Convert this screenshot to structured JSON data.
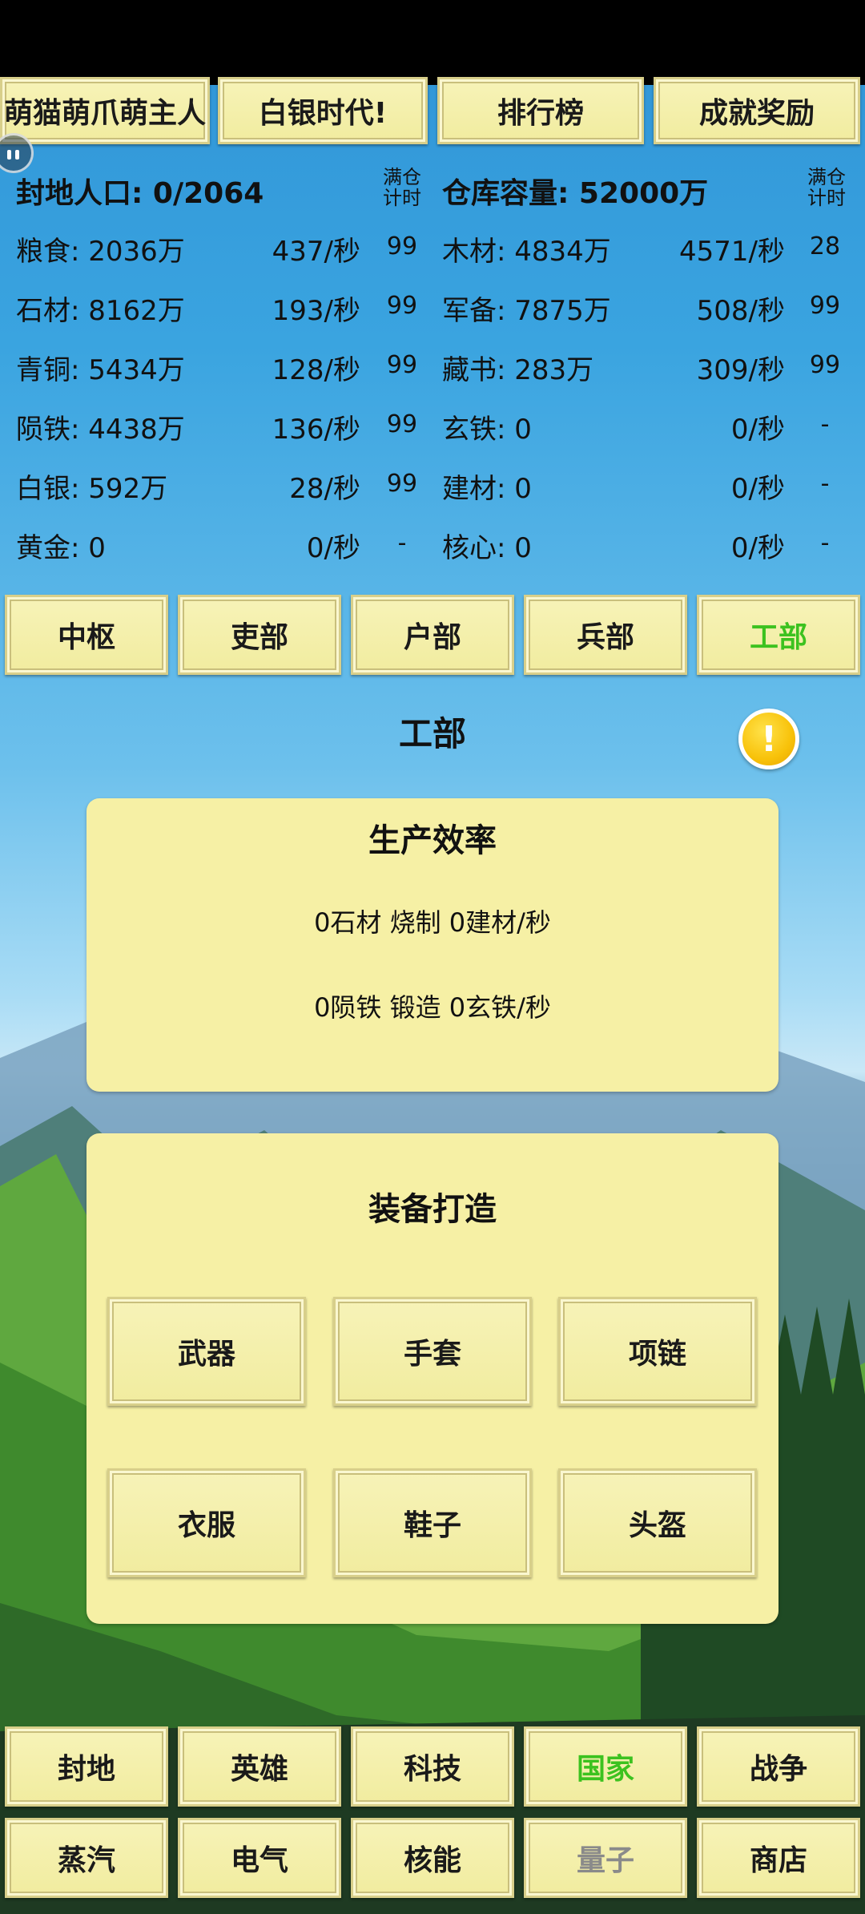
{
  "top_tabs": [
    "萌猫萌爪萌主人",
    "白银时代!",
    "排行榜",
    "成就奖励"
  ],
  "resources": {
    "population_label": "封地人口: 0/2064",
    "warehouse_label": "仓库容量: 52000万",
    "full_timer_label_left": "满仓计时",
    "full_timer_label_right": "满仓计时",
    "left": [
      {
        "name": "粮食: 2036万",
        "rate": "437/秒",
        "count": "99"
      },
      {
        "name": "石材: 8162万",
        "rate": "193/秒",
        "count": "99"
      },
      {
        "name": "青铜: 5434万",
        "rate": "128/秒",
        "count": "99"
      },
      {
        "name": "陨铁: 4438万",
        "rate": "136/秒",
        "count": "99"
      },
      {
        "name": "白银: 592万",
        "rate": "28/秒",
        "count": "99"
      },
      {
        "name": "黄金: 0",
        "rate": "0/秒",
        "count": "-"
      }
    ],
    "right": [
      {
        "name": "木材: 4834万",
        "rate": "4571/秒",
        "count": "28"
      },
      {
        "name": "军备: 7875万",
        "rate": "508/秒",
        "count": "99"
      },
      {
        "name": "藏书: 283万",
        "rate": "309/秒",
        "count": "99"
      },
      {
        "name": "玄铁: 0",
        "rate": "0/秒",
        "count": "-"
      },
      {
        "name": "建材: 0",
        "rate": "0/秒",
        "count": "-"
      },
      {
        "name": "核心: 0",
        "rate": "0/秒",
        "count": "-"
      }
    ]
  },
  "dept_tabs": [
    "中枢",
    "吏部",
    "户部",
    "兵部",
    "工部"
  ],
  "active_dept": "工部",
  "section_title": "工部",
  "alert_symbol": "!",
  "production": {
    "title": "生产效率",
    "lines": [
      "0石材 烧制 0建材/秒",
      "0陨铁 锻造 0玄铁/秒"
    ]
  },
  "equipment": {
    "title": "装备打造",
    "items": [
      "武器",
      "手套",
      "项链",
      "衣服",
      "鞋子",
      "头盔"
    ]
  },
  "nav_row1": [
    "封地",
    "英雄",
    "科技",
    "国家",
    "战争"
  ],
  "nav_row2": [
    "蒸汽",
    "电气",
    "核能",
    "量子",
    "商店"
  ],
  "active_nav": "国家",
  "disabled_nav": "量子",
  "colors": {
    "active_green": "#3cc21f",
    "panel_yellow": "#f6f0a5",
    "disabled_gray": "#8a8a8a"
  }
}
